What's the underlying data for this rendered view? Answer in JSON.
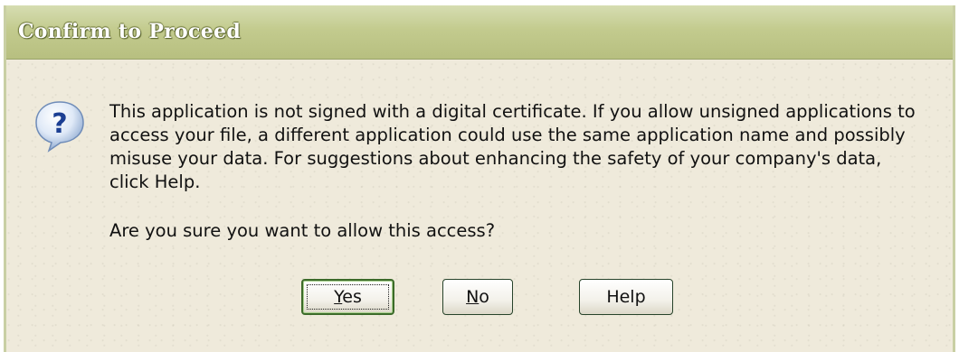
{
  "dialog": {
    "title": "Confirm to Proceed",
    "icon": "question-icon",
    "message": "This application is not signed with a digital certificate.  If you allow unsigned applications to access your file, a different application could use the same application name and possibly misuse your data.  For suggestions about enhancing the safety of your company's data, click Help.",
    "question": "Are you sure you want to allow this access?",
    "buttons": {
      "yes_first": "Y",
      "yes_rest": "es",
      "no_first": "N",
      "no_rest": "o",
      "help": "Help"
    }
  },
  "colors": {
    "titlebar": "#c3cb8e",
    "background": "#efeadb",
    "default_button_border": "#3c6b2a"
  }
}
